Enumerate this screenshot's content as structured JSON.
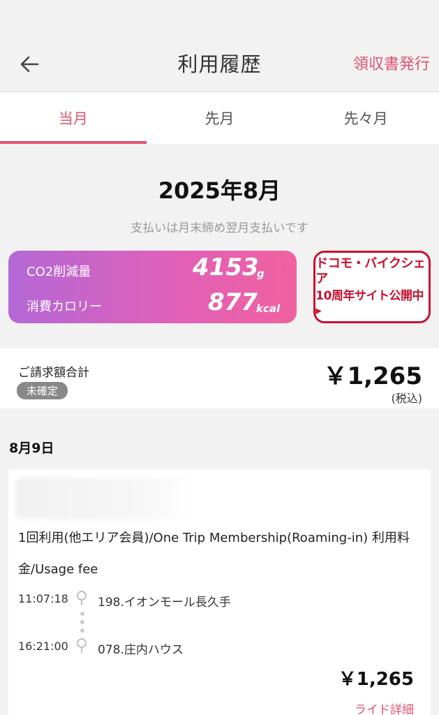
{
  "header": {
    "title": "利用履歴",
    "receipt_label": "領収書発行"
  },
  "tabs": [
    {
      "label": "当月",
      "active": true
    },
    {
      "label": "先月",
      "active": false
    },
    {
      "label": "先々月",
      "active": false
    }
  ],
  "month": {
    "title": "2025年8月",
    "note": "支払いは月末締め翌月支払いです"
  },
  "eco": {
    "co2_label": "CO2削減量",
    "co2_value": "4153",
    "co2_unit": "g",
    "calorie_label": "消費カロリー",
    "calorie_value": "877",
    "calorie_unit": "kcal"
  },
  "promo": {
    "line1": "ドコモ・バイクシェア",
    "line2": "10周年サイト公開中▸"
  },
  "billing": {
    "label": "ご請求額合計",
    "status": "未確定",
    "amount": "￥1,265",
    "tax_note": "(税込)"
  },
  "rides": [
    {
      "date": "8月9日",
      "plan": "1回利用(他エリア会員)/One Trip Membership(Roaming-in) 利用料金/Usage fee",
      "start_time": "11:07:18",
      "start_station": "198.イオンモール長久手",
      "end_time": "16:21:00",
      "end_station": "078.庄内ハウス",
      "price": "￥1,265",
      "detail_label": "ライド詳細"
    }
  ],
  "colors": {
    "accent": "#e05470",
    "promo_red": "#c8102e",
    "eco_gradient_start": "#b368d6",
    "eco_gradient_end": "#f0619e"
  }
}
